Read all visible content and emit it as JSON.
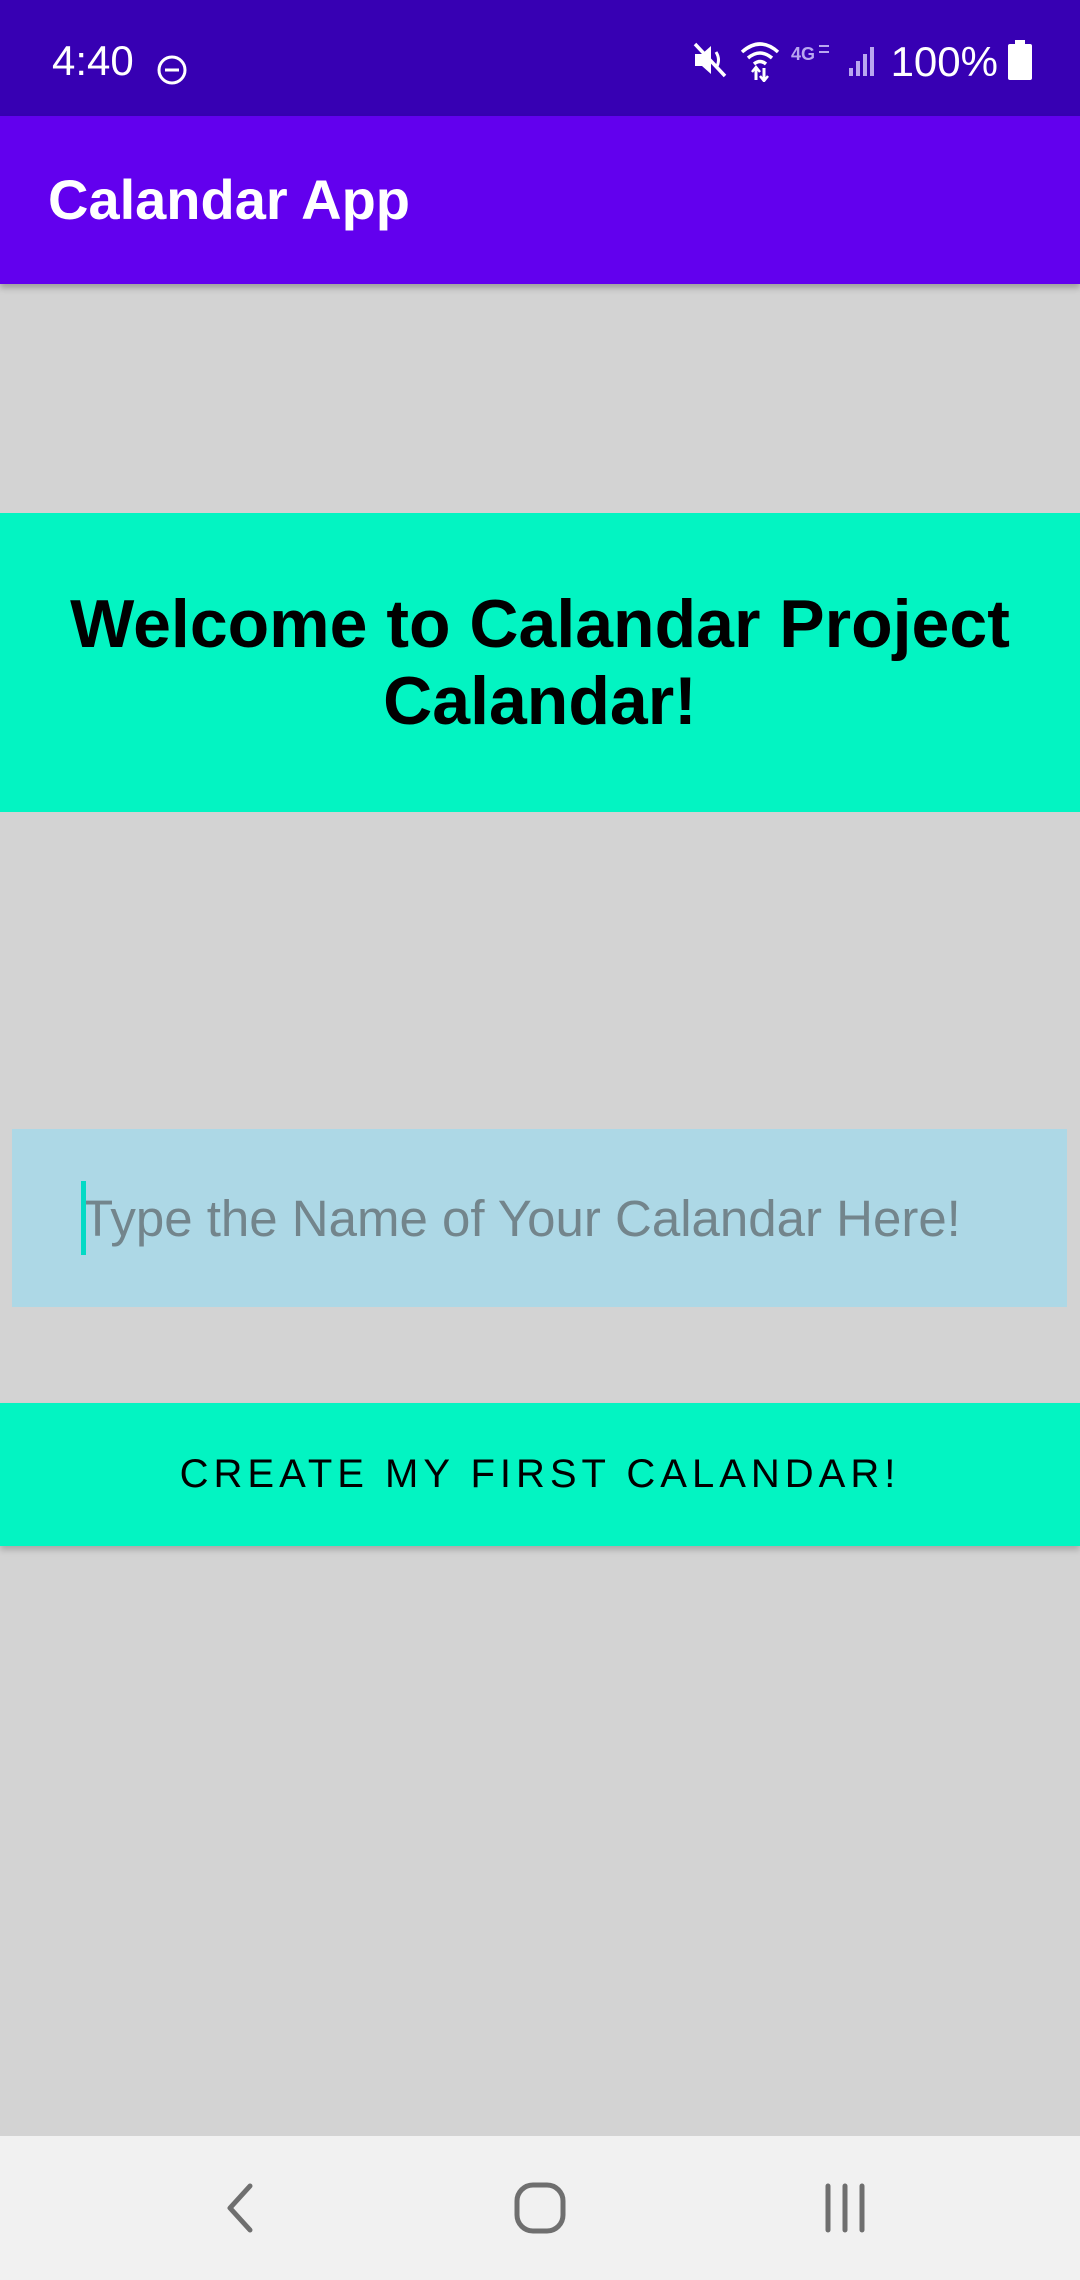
{
  "status_bar": {
    "time": "4:40",
    "battery": "100%",
    "icons": [
      "do-not-disturb-icon",
      "mute-icon",
      "wifi-icon",
      "4g-icon",
      "signal-icon",
      "battery-icon"
    ]
  },
  "app_bar": {
    "title": "Calandar App"
  },
  "welcome": {
    "text": "Welcome to Calandar Project Calandar!"
  },
  "name_input": {
    "value": "",
    "placeholder": "Type the Name of Your Calandar Here!"
  },
  "create_button": {
    "label": "CREATE MY FIRST CALANDAR!"
  },
  "nav_bar": {
    "icons": [
      "back-icon",
      "home-icon",
      "recents-icon"
    ]
  },
  "colors": {
    "status_bar": "#3700b3",
    "app_bar": "#6200ee",
    "accent": "#03f4c2",
    "input_background": "#add8e6",
    "screen_background": "#d3d3d3",
    "cursor": "#03dac5"
  }
}
